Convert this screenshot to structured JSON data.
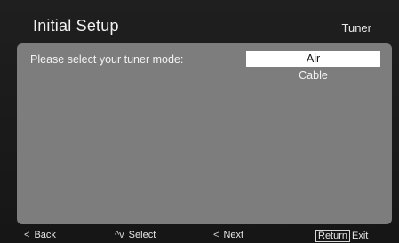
{
  "header": {
    "title": "Initial Setup",
    "section": "Tuner"
  },
  "panel": {
    "prompt": "Please select your tuner mode:",
    "options": [
      {
        "label": "Air",
        "selected": true
      },
      {
        "label": "Cable",
        "selected": false
      }
    ]
  },
  "footer": {
    "back": {
      "glyph": "<",
      "label": "Back"
    },
    "select": {
      "glyph": "^v",
      "label": "Select"
    },
    "next": {
      "glyph": "<",
      "label": "Next"
    },
    "exit": {
      "key": "Return",
      "label": "Exit"
    }
  },
  "colors": {
    "panel": "#7d7d7e",
    "highlight": "#ffffff",
    "background": "#1a1a1a"
  }
}
